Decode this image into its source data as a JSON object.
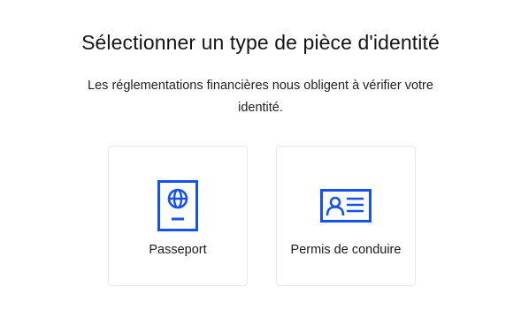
{
  "header": {
    "title": "Sélectionner un type de pièce d'identité",
    "subtitle": "Les réglementations financières nous obligent à vérifier votre identité."
  },
  "options": [
    {
      "label": "Passeport",
      "icon": "passport-icon"
    },
    {
      "label": "Permis de conduire",
      "icon": "id-card-icon"
    }
  ],
  "colors": {
    "accent": "#1652f0",
    "card_border": "#e6e8ec",
    "text": "#1a1a1a"
  }
}
